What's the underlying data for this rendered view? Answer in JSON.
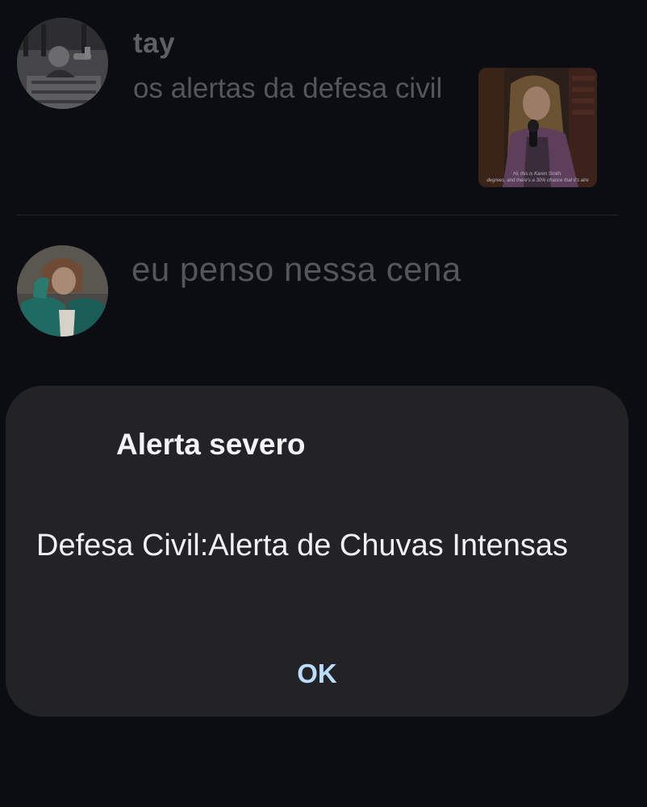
{
  "feed": {
    "posts": [
      {
        "username": "tay",
        "text": "os alertas da defesa civil",
        "thumbnail": {
          "caption_line1": "Hi, this is Karen Smith.",
          "caption_line2": "degrees, and there's a 30% chance that it's alre"
        }
      },
      {
        "text": "eu penso nessa cena"
      }
    ]
  },
  "dialog": {
    "title": "Alerta severo",
    "message": "Defesa Civil:Alerta de Chuvas Intensas",
    "ok_label": "OK"
  },
  "colors": {
    "background": "#0c0d12",
    "dialog_surface": "#232326",
    "dialog_text": "#f1f1f3",
    "ok_accent": "#b9dcff",
    "dimmed_text": "#55565c"
  }
}
